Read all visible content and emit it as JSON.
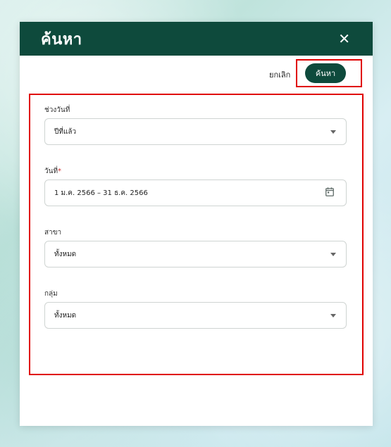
{
  "dialog": {
    "title": "ค้นหา",
    "close_icon": "close-icon",
    "cancel_label": "ยกเลิก",
    "search_label": "ค้นหา",
    "accent_color": "#0e4a3c",
    "highlight_color": "#e00000"
  },
  "fields": {
    "period": {
      "label": "ช่วงวันที่",
      "value": "ปีที่แล้ว",
      "icon": "chevron-down-icon"
    },
    "date": {
      "label": "วันที่",
      "required_mark": "*",
      "value": "1 ม.ค. 2566 – 31 ธ.ค. 2566",
      "icon": "calendar-icon"
    },
    "branch": {
      "label": "สาขา",
      "value": "ทั้งหมด",
      "icon": "chevron-down-icon"
    },
    "group": {
      "label": "กลุ่ม",
      "value": "ทั้งหมด",
      "icon": "chevron-down-icon"
    }
  }
}
